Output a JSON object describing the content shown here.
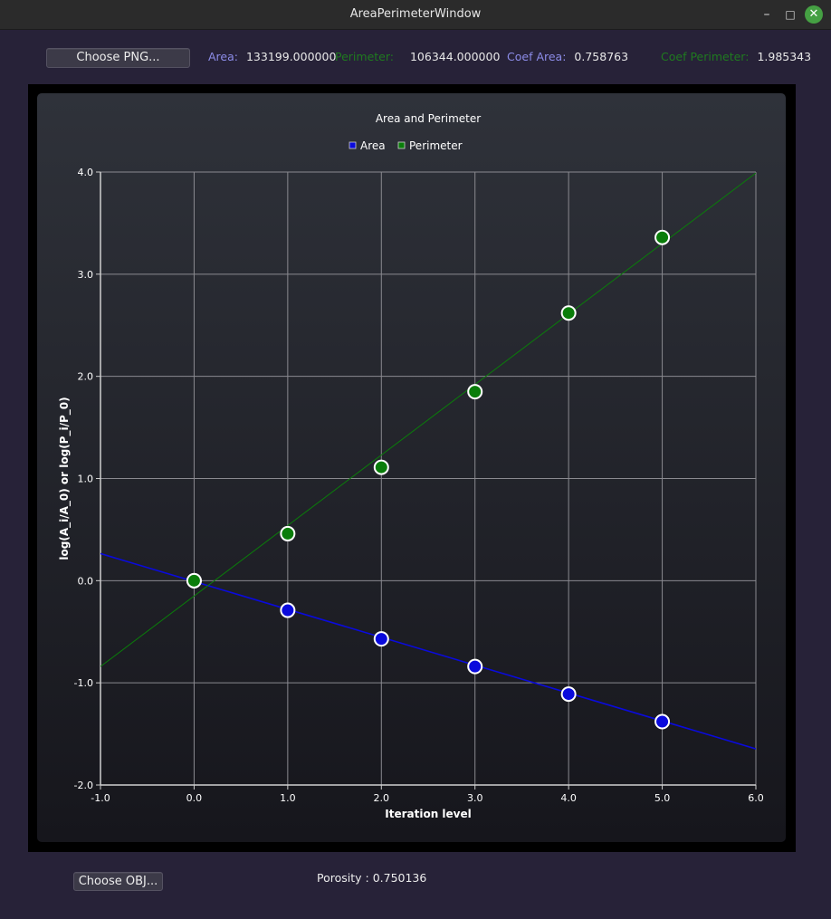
{
  "window": {
    "title": "AreaPerimeterWindow",
    "min_glyph": "–",
    "max_glyph": "□",
    "close_glyph": "✕"
  },
  "toolbar": {
    "choose_png_label": "Choose PNG...",
    "area_label": "Area:",
    "area_value": "133199.000000",
    "perimeter_label": "Perimeter:",
    "perimeter_value": "106344.000000",
    "coef_area_label": "Coef Area:",
    "coef_area_value": "0.758763",
    "coef_perimeter_label": "Coef Perimeter:",
    "coef_perimeter_value": "1.985343"
  },
  "colors": {
    "area_label": "#8c8ce8",
    "perimeter_label": "#1f7a1f",
    "area_series": "#0a0adc",
    "perimeter_series": "#0a7d0a"
  },
  "footer": {
    "choose_obj_label": "Choose OBJ...",
    "porosity_text": "Porosity : 0.750136"
  },
  "chart_data": {
    "type": "scatter",
    "title": "Area and Perimeter",
    "xlabel": "Iteration level",
    "ylabel": "log(A_i/A_0) or log(P_i/P_0)",
    "xlim": [
      -1.0,
      6.0
    ],
    "ylim": [
      -2.0,
      4.0
    ],
    "x_ticks": [
      "-1.0",
      "0.0",
      "1.0",
      "2.0",
      "3.0",
      "4.0",
      "5.0",
      "6.0"
    ],
    "y_ticks": [
      "-2.0",
      "-1.0",
      "0.0",
      "1.0",
      "2.0",
      "3.0",
      "4.0"
    ],
    "grid": true,
    "legend_position": "top-center",
    "series": [
      {
        "name": "Area",
        "color": "#0a0adc",
        "points": [
          [
            0,
            0.0
          ],
          [
            1,
            -0.29
          ],
          [
            2,
            -0.57
          ],
          [
            3,
            -0.84
          ],
          [
            4,
            -1.11
          ],
          [
            5,
            -1.38
          ]
        ],
        "fit_line": {
          "slope": -0.273,
          "intercept": -0.008
        }
      },
      {
        "name": "Perimeter",
        "color": "#0a7d0a",
        "points": [
          [
            0,
            0.0
          ],
          [
            1,
            0.46
          ],
          [
            2,
            1.11
          ],
          [
            3,
            1.85
          ],
          [
            4,
            2.62
          ],
          [
            5,
            3.36
          ]
        ],
        "fit_line": {
          "slope": 0.69,
          "intercept": -0.15
        }
      }
    ]
  }
}
